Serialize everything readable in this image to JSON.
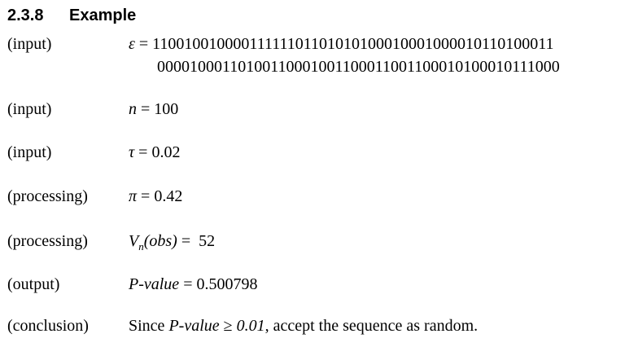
{
  "heading": {
    "number": "2.3.8",
    "title": "Example"
  },
  "rows": [
    {
      "label": "(input)",
      "symbol": "ε",
      "op": " = ",
      "value_line1": "11001001000011111101101010100010001000010110100011",
      "value_line2": "00001000110100110001001100011001100010100010111000"
    },
    {
      "label": "(input)",
      "symbol": "n",
      "op": " = ",
      "value": "100"
    },
    {
      "label": "(input)",
      "symbol": "τ",
      "op": " = ",
      "value": "0.02"
    },
    {
      "label": "(processing)",
      "symbol": "π",
      "op": " = ",
      "value": "0.42"
    },
    {
      "label": "(processing)",
      "symbol": "V",
      "subscript": "n",
      "symbol_suffix": "(obs)",
      "op": " =  ",
      "value": "52"
    },
    {
      "label": "(output)",
      "symbol": "P-value",
      "op": " = ",
      "value": "0.500798"
    },
    {
      "label": "(conclusion)",
      "text_prefix": "Since ",
      "italic1": "P-value",
      "ge": " ≥ ",
      "italic2": "0.01",
      "text_suffix": ", accept the sequence as random."
    }
  ]
}
